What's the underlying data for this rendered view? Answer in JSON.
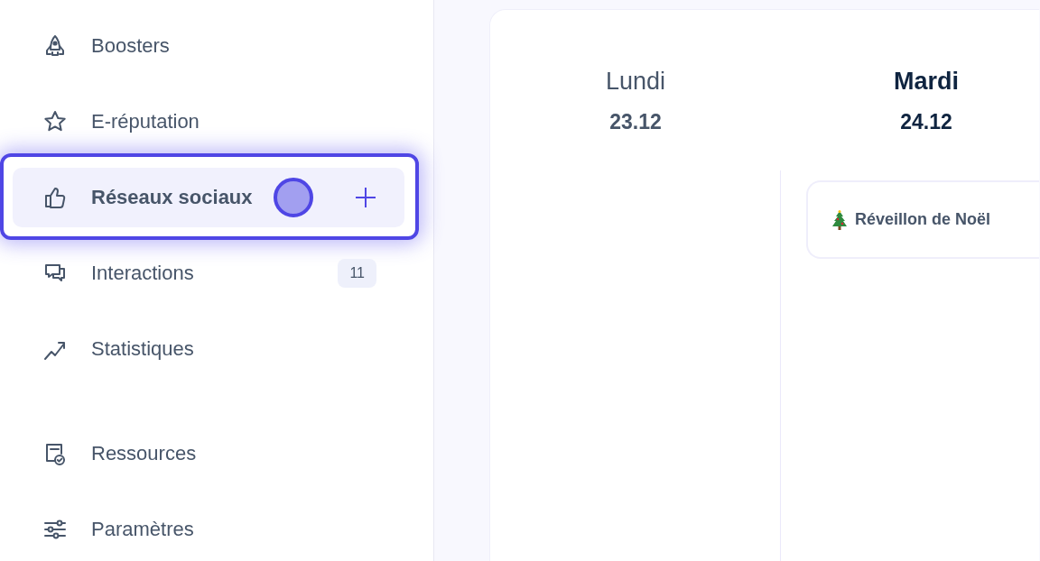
{
  "sidebar": {
    "sections": [
      {
        "items": [
          {
            "label": "Boosters",
            "kind": "rocket",
            "selected": false
          },
          {
            "label": "E-réputation",
            "kind": "star",
            "selected": false
          },
          {
            "label": "Réseaux sociaux",
            "kind": "thumb",
            "selected": true
          },
          {
            "label": "Interactions",
            "kind": "chat",
            "selected": false,
            "badge": "11"
          },
          {
            "label": "Statistiques",
            "kind": "trend",
            "selected": false
          }
        ]
      },
      {
        "items": [
          {
            "label": "Ressources",
            "kind": "doc",
            "selected": false
          },
          {
            "label": "Paramètres",
            "kind": "sliders",
            "selected": false
          }
        ]
      }
    ]
  },
  "calendar": {
    "days": [
      {
        "name": "Lundi",
        "date": "23.12",
        "today": false
      },
      {
        "name": "Mardi",
        "date": "24.12",
        "today": true,
        "events": [
          {
            "kind": "holiday",
            "title": "Réveillon de Noël"
          }
        ]
      }
    ]
  }
}
